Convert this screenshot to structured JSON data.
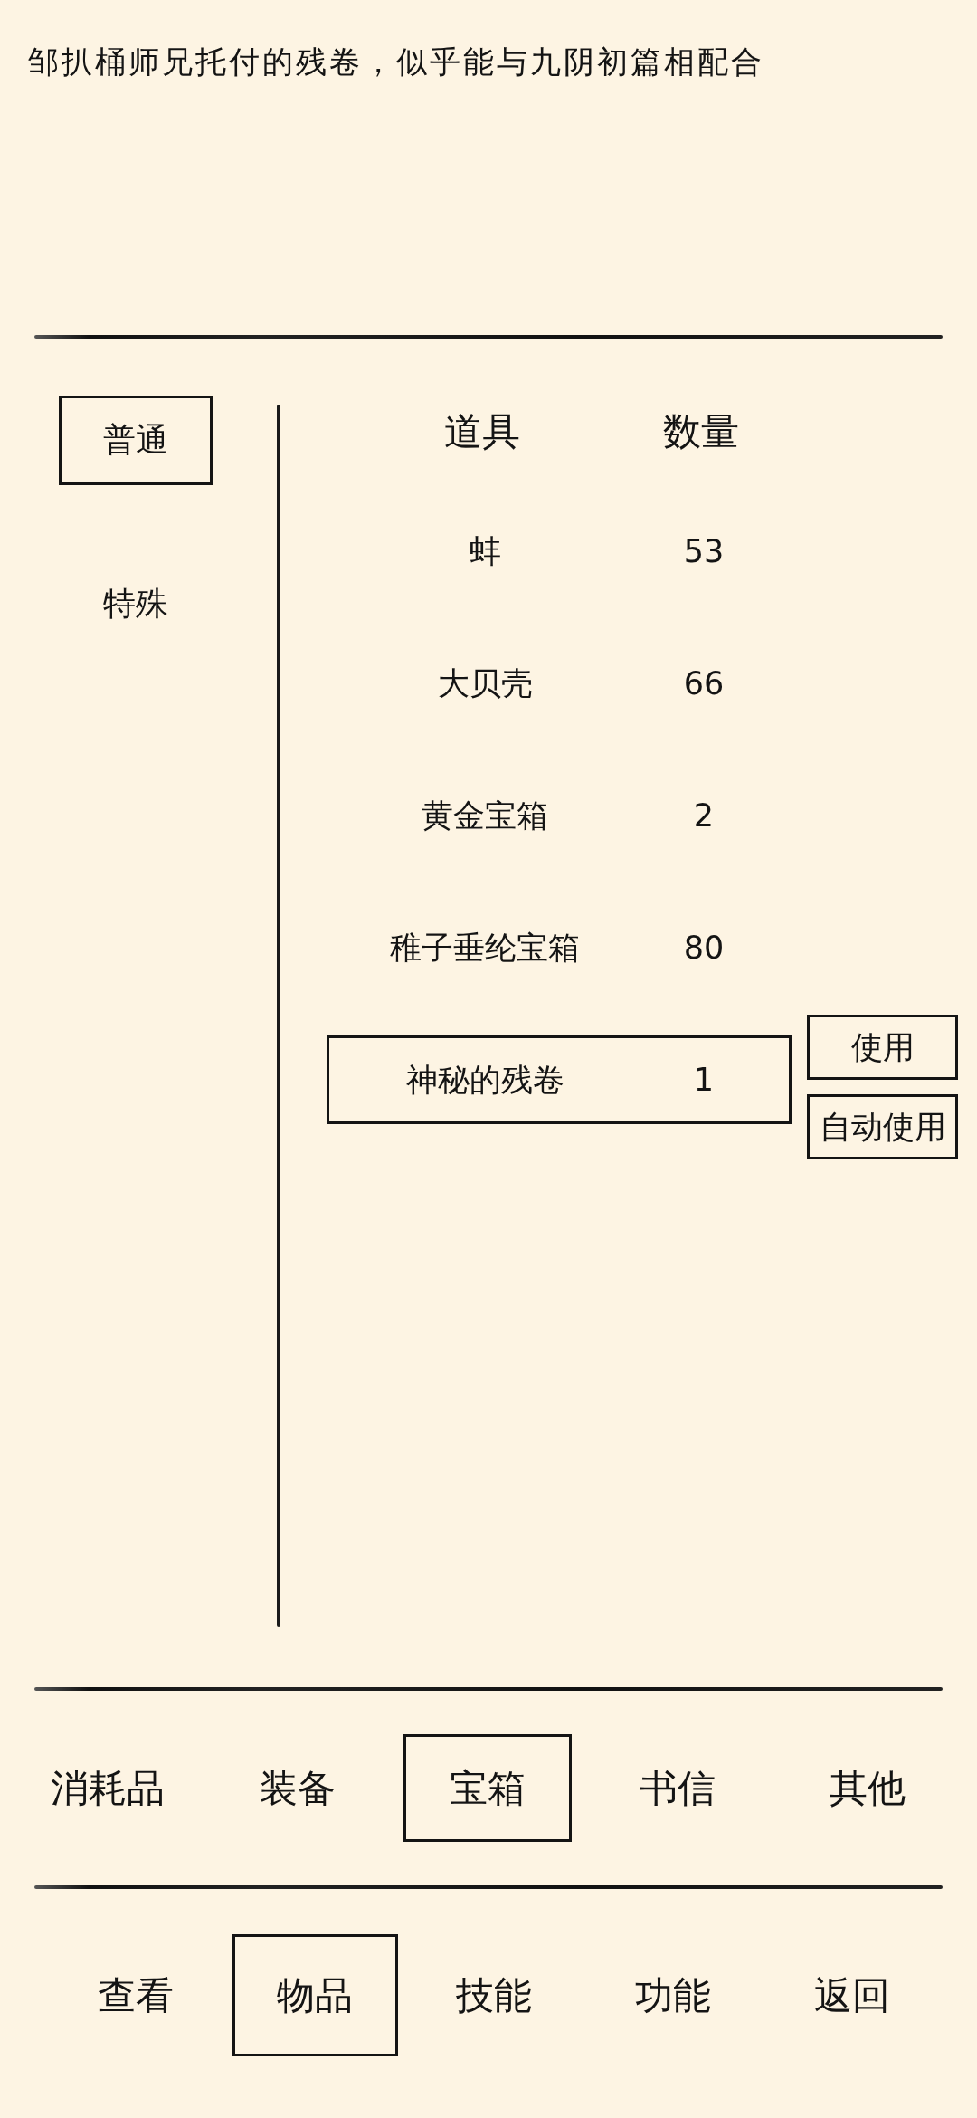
{
  "description": "邹扒桶师兄托付的残卷，似乎能与九阴初篇相配合",
  "filters": [
    {
      "label": "普通",
      "selected": true
    },
    {
      "label": "特殊",
      "selected": false
    }
  ],
  "table": {
    "columns": [
      "道具",
      "数量"
    ],
    "rows": [
      {
        "name": "蚌",
        "count": "53",
        "selected": false
      },
      {
        "name": "大贝壳",
        "count": "66",
        "selected": false
      },
      {
        "name": "黄金宝箱",
        "count": "2",
        "selected": false
      },
      {
        "name": "稚子垂纶宝箱",
        "count": "80",
        "selected": false
      },
      {
        "name": "神秘的残卷",
        "count": "1",
        "selected": true
      }
    ],
    "actions": [
      {
        "label": "使用"
      },
      {
        "label": "自动使用"
      }
    ]
  },
  "category_tabs": [
    {
      "label": "消耗品",
      "selected": false
    },
    {
      "label": "装备",
      "selected": false
    },
    {
      "label": "宝箱",
      "selected": true
    },
    {
      "label": "书信",
      "selected": false
    },
    {
      "label": "其他",
      "selected": false
    }
  ],
  "nav": [
    {
      "label": "查看",
      "selected": false
    },
    {
      "label": "物品",
      "selected": true
    },
    {
      "label": "技能",
      "selected": false
    },
    {
      "label": "功能",
      "selected": false
    },
    {
      "label": "返回",
      "selected": false
    }
  ]
}
